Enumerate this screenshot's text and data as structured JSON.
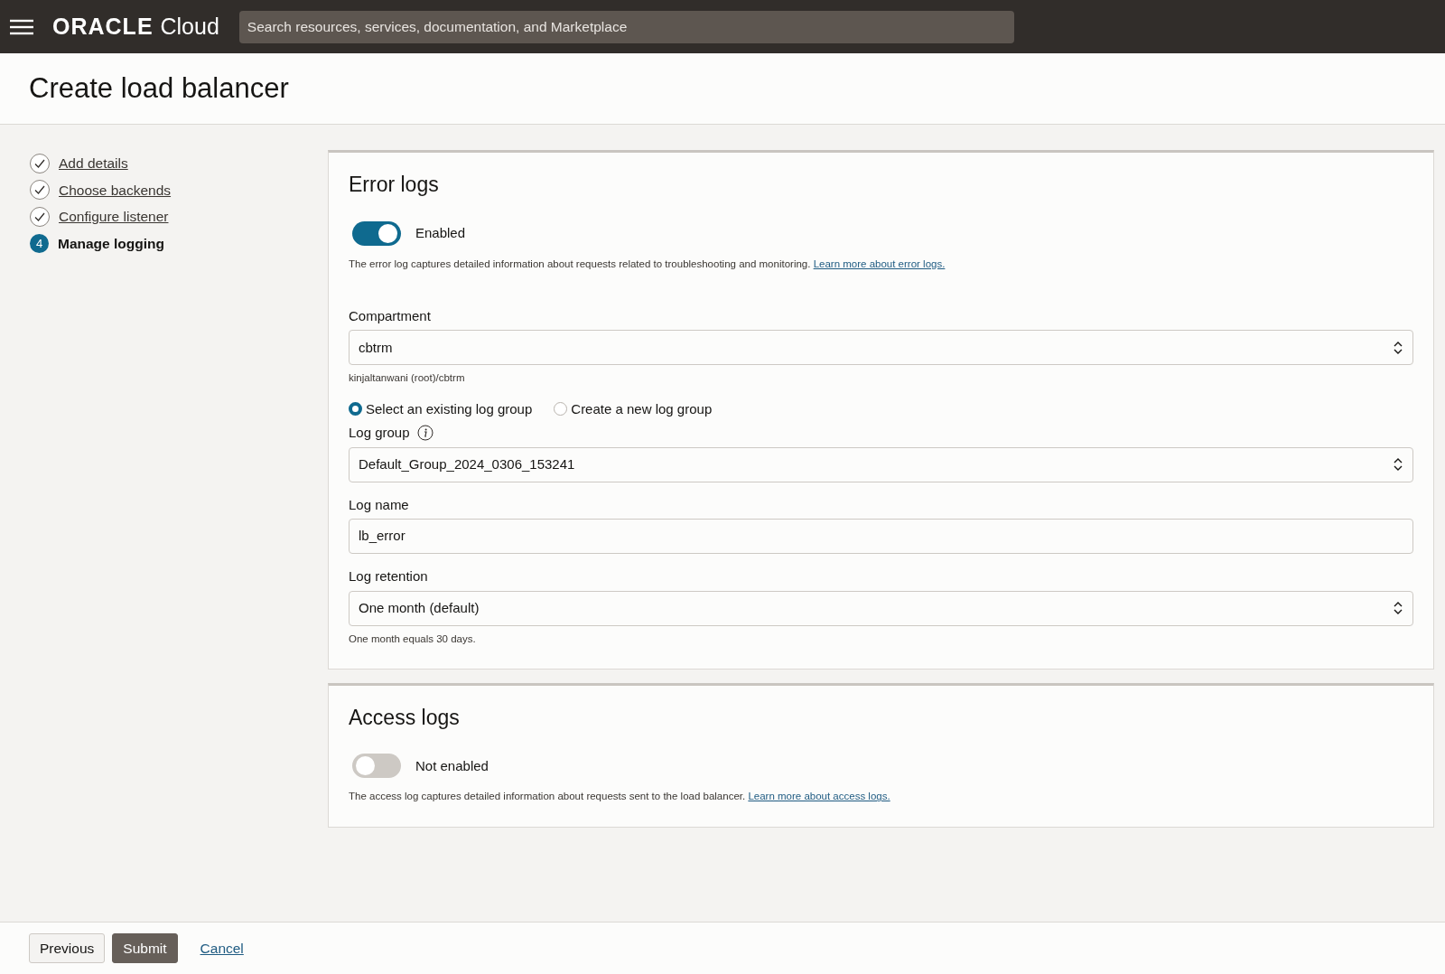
{
  "topbar": {
    "logo": "ORACLE",
    "logo_suffix": "Cloud",
    "search": {
      "placeholder": "Search resources, services, documentation, and Marketplace"
    }
  },
  "page_title": "Create load balancer",
  "steps": [
    {
      "label": "Add details",
      "completed": true,
      "selected": false
    },
    {
      "label": "Choose backends",
      "completed": true,
      "selected": false
    },
    {
      "label": "Configure listener",
      "completed": true,
      "selected": false
    },
    {
      "label": "Manage logging",
      "number": "4",
      "completed": false,
      "selected": true
    }
  ],
  "sections": [
    {
      "title": "Error logs",
      "enabled": true,
      "toggle_label": "Enabled",
      "description": "The error log captures detailed information about requests related to troubleshooting and monitoring.",
      "link": "Learn more about error logs.",
      "fields": [
        {
          "kind": "select",
          "label": "Compartment",
          "value": "cbtrm",
          "help": "kinjaltanwani (root)/cbtrm"
        },
        {
          "kind": "radios",
          "options": [
            {
              "label": "Select an existing log group",
              "selected": true
            },
            {
              "label": "Create a new log group",
              "selected": false
            }
          ]
        },
        {
          "kind": "select",
          "label": "Log group",
          "info": true,
          "value": "Default_Group_2024_0306_153241"
        },
        {
          "kind": "text",
          "label": "Log name",
          "value": "lb_error"
        },
        {
          "kind": "select",
          "label": "Log retention",
          "value": "One month (default)",
          "help": "One month equals 30 days."
        }
      ]
    },
    {
      "title": "Access logs",
      "enabled": false,
      "toggle_label": "Not enabled",
      "description": "The access log captures detailed information about requests sent to the load balancer.",
      "link": "Learn more about access logs."
    }
  ],
  "footer": [
    {
      "label": "Previous",
      "kind": "secondary"
    },
    {
      "label": "Submit",
      "kind": "primary"
    },
    {
      "label": "Cancel",
      "kind": "link"
    }
  ]
}
